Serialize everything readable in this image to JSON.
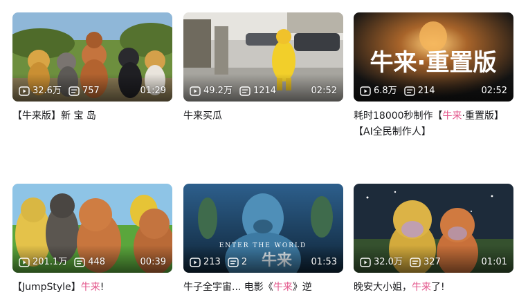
{
  "accent_color": "#e3548a",
  "videos": [
    {
      "views": "32.6万",
      "danmaku": "757",
      "duration": "01:29",
      "title_parts": [
        "【牛来版】新 宝 岛"
      ]
    },
    {
      "views": "49.2万",
      "danmaku": "1214",
      "duration": "02:52",
      "title_parts": [
        "牛来买瓜"
      ]
    },
    {
      "views": "6.8万",
      "danmaku": "214",
      "duration": "02:52",
      "overlay_text": "牛来·重置版",
      "title_parts": [
        "耗时18000秒制作【",
        "牛来",
        "·重置版】 【AI全民制作人】"
      ]
    },
    {
      "views": "201.1万",
      "danmaku": "448",
      "duration": "00:39",
      "title_parts": [
        "【JumpStyle】",
        "牛来",
        "!"
      ]
    },
    {
      "views": "213",
      "danmaku": "2",
      "duration": "01:53",
      "overlay_text": "ENTER THE WORLD",
      "overlay_text_2": "牛来",
      "title_parts": [
        "牛子全宇宙... 电影《",
        "牛来",
        "》逆"
      ]
    },
    {
      "views": "32.0万",
      "danmaku": "327",
      "duration": "01:01",
      "title_parts": [
        "晚安大小姐，",
        "牛来",
        "了!"
      ]
    }
  ],
  "icons": {
    "views": "play-count-icon",
    "danmaku": "danmaku-count-icon"
  }
}
